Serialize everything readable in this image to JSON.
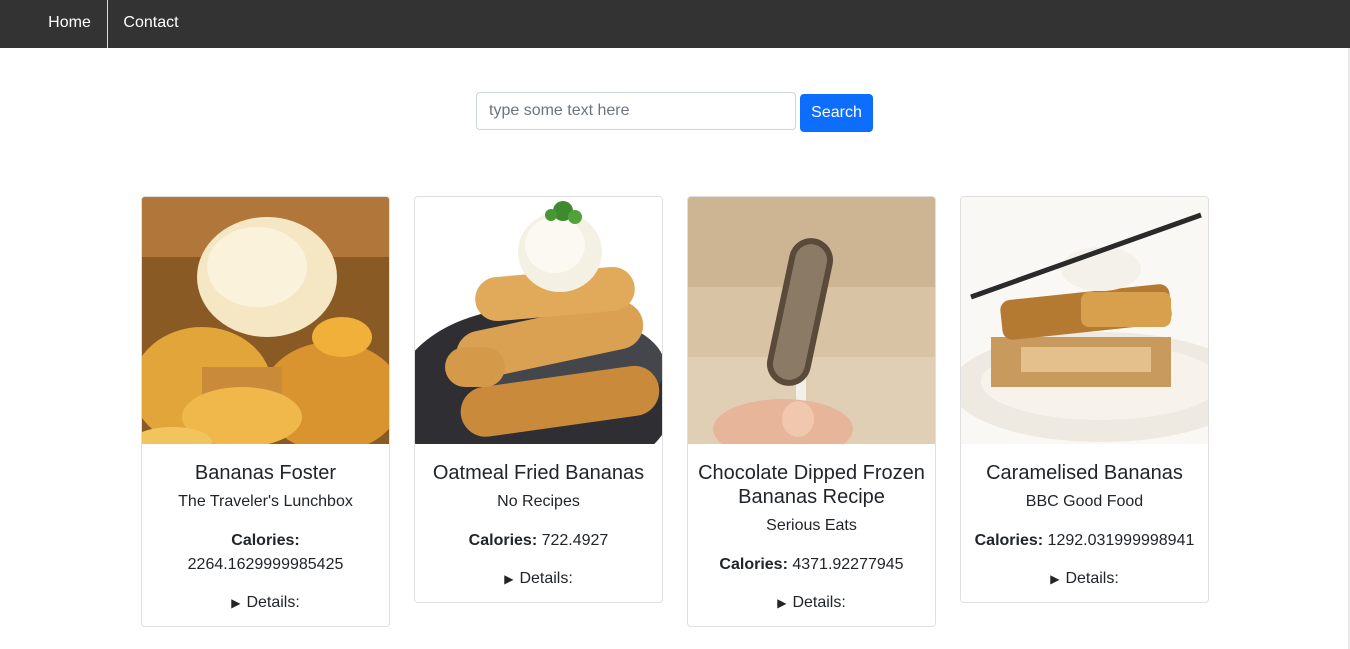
{
  "nav": {
    "home_label": "Home",
    "contact_label": "Contact"
  },
  "search": {
    "placeholder": "type some text here",
    "value": "",
    "button_label": "Search"
  },
  "cards": [
    {
      "title": "Bananas Foster",
      "source": "The Traveler's Lunchbox",
      "calories_label": "Calories:",
      "calories_value": "2264.1629999985425",
      "details_label": "Details:",
      "details_icon": "triangle-right-icon"
    },
    {
      "title": "Oatmeal Fried Bananas",
      "source": "No Recipes",
      "calories_label": "Calories:",
      "calories_value": "722.4927",
      "details_label": "Details:",
      "details_icon": "triangle-right-icon"
    },
    {
      "title": "Chocolate Dipped Frozen Bananas Recipe",
      "source": "Serious Eats",
      "calories_label": "Calories:",
      "calories_value": "4371.92277945",
      "details_label": "Details:",
      "details_icon": "triangle-right-icon"
    },
    {
      "title": "Caramelised Bananas",
      "source": "BBC Good Food",
      "calories_label": "Calories:",
      "calories_value": "1292.031999998941",
      "details_label": "Details:",
      "details_icon": "triangle-right-icon"
    }
  ],
  "colors": {
    "navbar": "#333333",
    "primary": "#0d6efd"
  }
}
